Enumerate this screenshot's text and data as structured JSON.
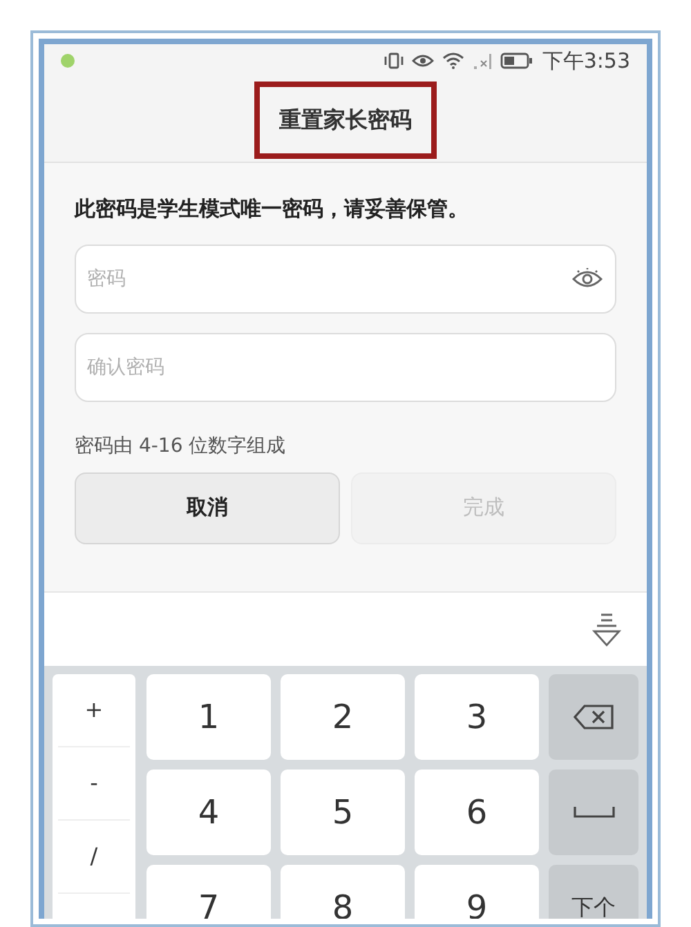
{
  "status_bar": {
    "time": "下午3:53"
  },
  "title": "重置家长密码",
  "intro": "此密码是学生模式唯一密码，请妥善保管。",
  "fields": [
    {
      "placeholder": "密码",
      "reveal_icon": true
    },
    {
      "placeholder": "确认密码",
      "reveal_icon": false
    }
  ],
  "hint": "密码由 4-16 位数字组成",
  "buttons": [
    {
      "label": "取消",
      "disabled": false
    },
    {
      "label": "完成",
      "disabled": true
    }
  ],
  "keyboard": {
    "symbols": [
      "+",
      "-",
      "/"
    ],
    "rows": [
      [
        {
          "kind": "digit",
          "label": "1"
        },
        {
          "kind": "digit",
          "label": "2"
        },
        {
          "kind": "digit",
          "label": "3"
        },
        {
          "kind": "backspace"
        }
      ],
      [
        {
          "kind": "digit",
          "label": "4"
        },
        {
          "kind": "digit",
          "label": "5"
        },
        {
          "kind": "digit",
          "label": "6"
        },
        {
          "kind": "space"
        }
      ],
      [
        {
          "kind": "digit",
          "label": "7"
        },
        {
          "kind": "digit",
          "label": "8"
        },
        {
          "kind": "digit",
          "label": "9"
        },
        {
          "kind": "action",
          "label": "下个"
        }
      ]
    ]
  }
}
